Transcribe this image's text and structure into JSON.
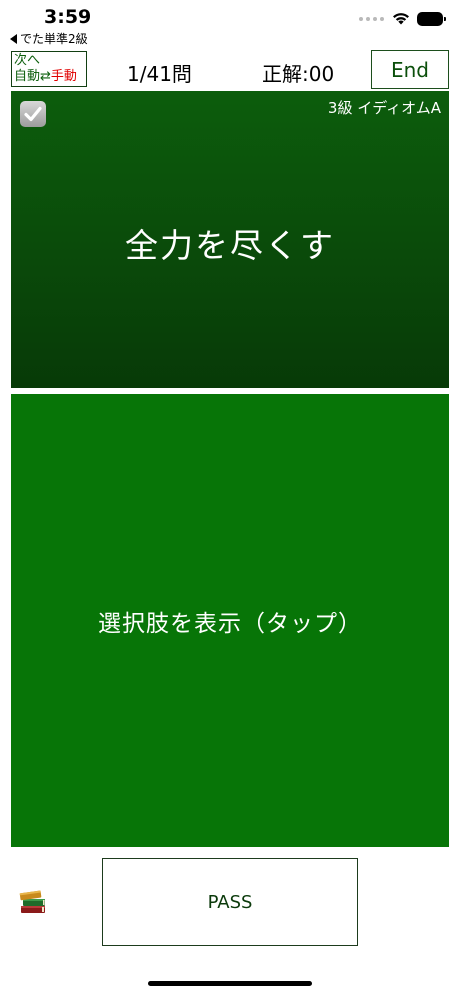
{
  "status_bar": {
    "time": "3:59",
    "back_app": "でた単準2級"
  },
  "header": {
    "mode_line1": "次へ",
    "mode_auto": "自動",
    "mode_arrows": "⇄",
    "mode_manual": "手動",
    "progress": "1/41問",
    "score": "正解:00",
    "end_label": "End"
  },
  "question": {
    "level": "3級 イディオムA",
    "text": "全力を尽くす",
    "checked": true
  },
  "choices": {
    "prompt": "選択肢を表示（タップ）"
  },
  "footer": {
    "pass_label": "PASS"
  },
  "colors": {
    "question_bg": "#0a4a0a",
    "choices_bg": "#077507",
    "manual_red": "#e00000"
  }
}
